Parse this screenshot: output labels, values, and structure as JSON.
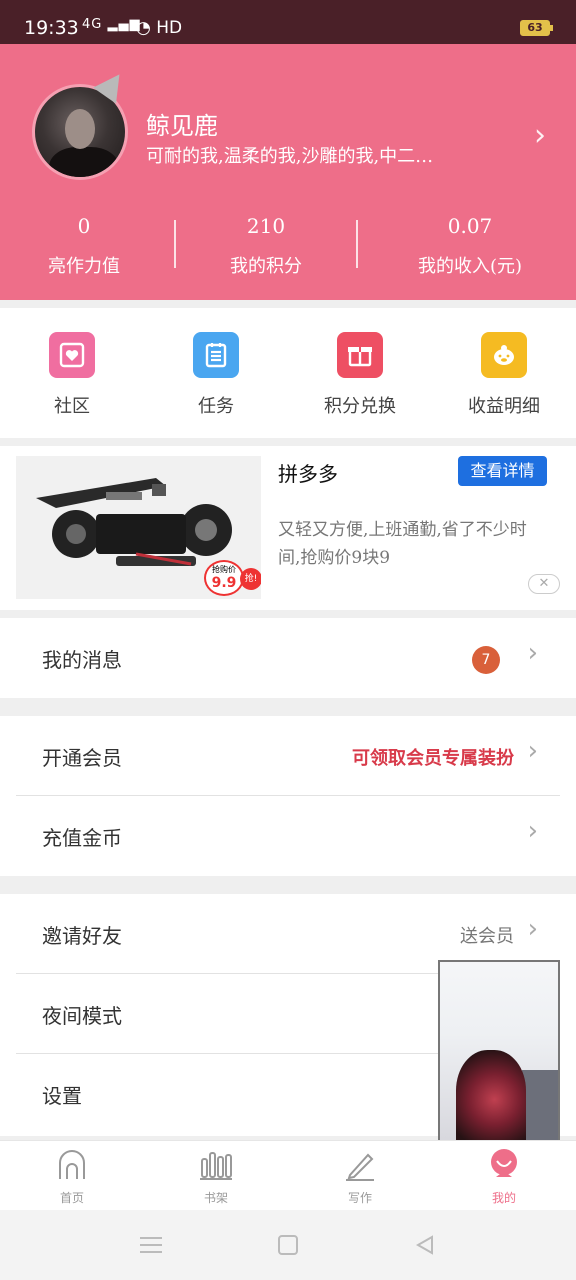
{
  "status_bar": {
    "time": "19:33",
    "signal": "4G",
    "network": "HD",
    "battery": "63"
  },
  "profile": {
    "name": "鲸见鹿",
    "signature": "可耐的我,温柔的我,沙雕的我,中二…",
    "stats": [
      {
        "value": "0",
        "label": "亮作力值"
      },
      {
        "value": "210",
        "label": "我的积分"
      },
      {
        "value": "0.07",
        "label": "我的收入(元)"
      }
    ]
  },
  "quick_menu": [
    {
      "label": "社区",
      "color": "#f06ea0",
      "icon": "heart-icon"
    },
    {
      "label": "任务",
      "color": "#4aa6f0",
      "icon": "clipboard-icon"
    },
    {
      "label": "积分兑换",
      "color": "#ee4f63",
      "icon": "gift-icon"
    },
    {
      "label": "收益明细",
      "color": "#f5bb22",
      "icon": "piggy-icon"
    }
  ],
  "ad": {
    "title": "拼多多",
    "button": "查看详情",
    "description": "又轻又方便,上班通勤,省了不少时间,抢购价9块9",
    "price_tag": "9.9",
    "price_label": "抢购价",
    "grab": "抢!",
    "close": "✕"
  },
  "menu": {
    "messages": {
      "label": "我的消息",
      "badge": "7"
    },
    "vip": {
      "label": "开通会员",
      "extra": "可领取会员专属装扮"
    },
    "coins": {
      "label": "充值金币"
    },
    "invite": {
      "label": "邀请好友",
      "extra": "送会员"
    },
    "night": {
      "label": "夜间模式"
    },
    "settings": {
      "label": "设置"
    }
  },
  "tabs": [
    {
      "label": "首页"
    },
    {
      "label": "书架"
    },
    {
      "label": "写作"
    },
    {
      "label": "我的"
    }
  ],
  "colors": {
    "primary": "#ee6e89",
    "accent_blue": "#1e6fe0",
    "badge": "#d9603a",
    "status_bar": "#4a2028"
  }
}
